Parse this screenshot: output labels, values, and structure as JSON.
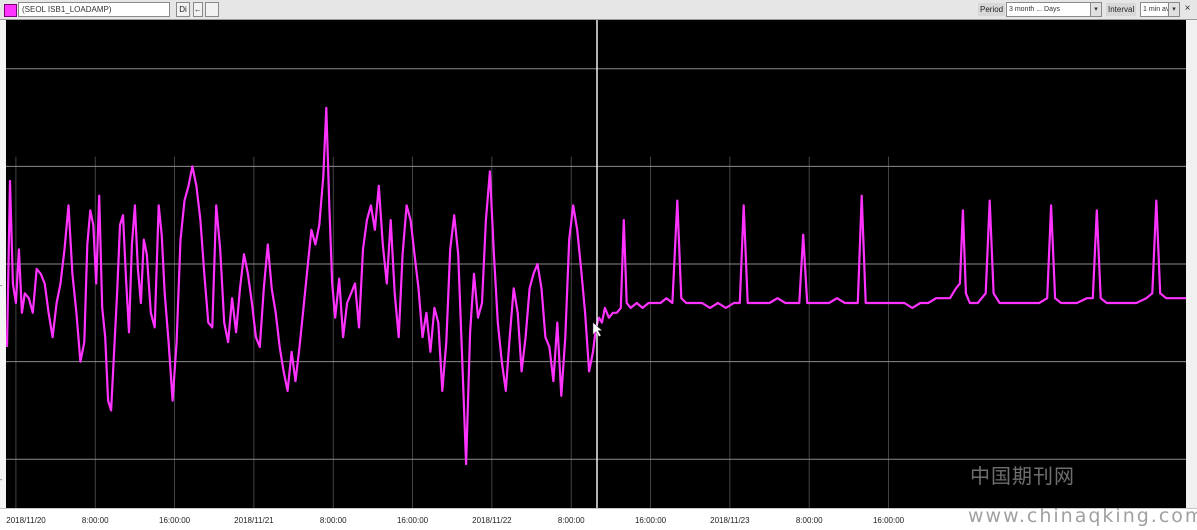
{
  "toolbar": {
    "tag_name": "(SEOL ISB1_LOADAMP)",
    "button_a": "Di",
    "button_b": "←",
    "period_label": "Period",
    "period_value": "3 month ... Days",
    "interval_label": "Interval",
    "interval_value": "1 min avg",
    "close_glyph": "×"
  },
  "colors": {
    "series": "#ff33ff",
    "background": "#000000",
    "grid": "#8a8a8a",
    "cursor": "#ffffff"
  },
  "watermark": {
    "chinese": "中国期刊网",
    "url": "www.chinaqking.com"
  },
  "chart_data": {
    "type": "line",
    "title": "",
    "xlabel": "",
    "ylabel": "",
    "x_tick_labels": [
      "2018/11/20",
      "8:00:00",
      "16:00:00",
      "2018/11/21",
      "8:00:00",
      "16:00:00",
      "2018/11/22",
      "8:00:00",
      "16:00:00",
      "2018/11/23",
      "8:00:00",
      "16:00:00"
    ],
    "x_tick_hours": [
      0,
      8,
      16,
      24,
      32,
      40,
      48,
      56,
      64,
      72,
      80,
      88
    ],
    "x_range_hours": [
      -1,
      118
    ],
    "y_range": [
      0,
      10
    ],
    "y_gridlines": [
      1,
      3,
      5,
      7,
      9
    ],
    "cursor_hour": 58.6,
    "grid": true,
    "series": [
      {
        "points": [
          [
            -0.9,
            3.3
          ],
          [
            -0.6,
            6.7
          ],
          [
            -0.3,
            4.6
          ],
          [
            0.0,
            4.2
          ],
          [
            0.3,
            5.3
          ],
          [
            0.6,
            4.0
          ],
          [
            0.9,
            4.4
          ],
          [
            1.3,
            4.3
          ],
          [
            1.7,
            4.0
          ],
          [
            2.1,
            4.9
          ],
          [
            2.5,
            4.8
          ],
          [
            2.9,
            4.6
          ],
          [
            3.3,
            4.0
          ],
          [
            3.7,
            3.5
          ],
          [
            4.1,
            4.2
          ],
          [
            4.5,
            4.6
          ],
          [
            4.9,
            5.3
          ],
          [
            5.3,
            6.2
          ],
          [
            5.7,
            4.8
          ],
          [
            6.1,
            4.0
          ],
          [
            6.5,
            3.0
          ],
          [
            6.9,
            3.4
          ],
          [
            7.2,
            5.4
          ],
          [
            7.5,
            6.1
          ],
          [
            7.8,
            5.8
          ],
          [
            8.1,
            4.6
          ],
          [
            8.4,
            6.4
          ],
          [
            8.7,
            4.1
          ],
          [
            9.0,
            3.5
          ],
          [
            9.3,
            2.2
          ],
          [
            9.6,
            2.0
          ],
          [
            9.9,
            3.2
          ],
          [
            10.2,
            4.4
          ],
          [
            10.5,
            5.8
          ],
          [
            10.8,
            6.0
          ],
          [
            11.1,
            4.7
          ],
          [
            11.4,
            3.6
          ],
          [
            11.7,
            5.4
          ],
          [
            12.0,
            6.2
          ],
          [
            12.3,
            4.9
          ],
          [
            12.6,
            4.2
          ],
          [
            12.9,
            5.5
          ],
          [
            13.2,
            5.2
          ],
          [
            13.6,
            4.0
          ],
          [
            14.0,
            3.7
          ],
          [
            14.4,
            6.2
          ],
          [
            14.7,
            5.6
          ],
          [
            15.0,
            4.4
          ],
          [
            15.4,
            3.4
          ],
          [
            15.8,
            2.2
          ],
          [
            16.2,
            3.4
          ],
          [
            16.6,
            5.5
          ],
          [
            17.0,
            6.3
          ],
          [
            17.4,
            6.6
          ],
          [
            17.8,
            7.0
          ],
          [
            18.2,
            6.6
          ],
          [
            18.6,
            5.9
          ],
          [
            19.0,
            4.8
          ],
          [
            19.4,
            3.8
          ],
          [
            19.8,
            3.7
          ],
          [
            20.2,
            6.2
          ],
          [
            20.6,
            5.3
          ],
          [
            21.0,
            3.8
          ],
          [
            21.4,
            3.4
          ],
          [
            21.8,
            4.3
          ],
          [
            22.2,
            3.6
          ],
          [
            22.6,
            4.5
          ],
          [
            23.0,
            5.2
          ],
          [
            23.4,
            4.8
          ],
          [
            23.8,
            4.2
          ],
          [
            24.2,
            3.5
          ],
          [
            24.6,
            3.3
          ],
          [
            25.0,
            4.5
          ],
          [
            25.4,
            5.4
          ],
          [
            25.8,
            4.5
          ],
          [
            26.2,
            4.0
          ],
          [
            26.6,
            3.3
          ],
          [
            27.0,
            2.8
          ],
          [
            27.4,
            2.4
          ],
          [
            27.8,
            3.2
          ],
          [
            28.2,
            2.6
          ],
          [
            28.6,
            3.3
          ],
          [
            29.0,
            4.1
          ],
          [
            29.4,
            4.9
          ],
          [
            29.8,
            5.7
          ],
          [
            30.2,
            5.4
          ],
          [
            30.6,
            5.8
          ],
          [
            31.0,
            6.8
          ],
          [
            31.3,
            8.2
          ],
          [
            31.6,
            6.2
          ],
          [
            31.9,
            4.6
          ],
          [
            32.2,
            3.9
          ],
          [
            32.6,
            4.7
          ],
          [
            33.0,
            3.5
          ],
          [
            33.4,
            4.2
          ],
          [
            33.8,
            4.4
          ],
          [
            34.2,
            4.6
          ],
          [
            34.6,
            3.7
          ],
          [
            35.0,
            5.3
          ],
          [
            35.4,
            5.9
          ],
          [
            35.8,
            6.2
          ],
          [
            36.2,
            5.7
          ],
          [
            36.6,
            6.6
          ],
          [
            37.0,
            5.4
          ],
          [
            37.4,
            4.6
          ],
          [
            37.8,
            5.9
          ],
          [
            38.2,
            4.4
          ],
          [
            38.6,
            3.5
          ],
          [
            39.0,
            5.2
          ],
          [
            39.4,
            6.2
          ],
          [
            39.8,
            5.9
          ],
          [
            40.2,
            5.2
          ],
          [
            40.6,
            4.5
          ],
          [
            41.0,
            3.5
          ],
          [
            41.4,
            4.0
          ],
          [
            41.8,
            3.2
          ],
          [
            42.2,
            4.1
          ],
          [
            42.6,
            3.8
          ],
          [
            43.0,
            2.4
          ],
          [
            43.4,
            3.4
          ],
          [
            43.8,
            5.3
          ],
          [
            44.2,
            6.0
          ],
          [
            44.6,
            5.2
          ],
          [
            45.0,
            3.1
          ],
          [
            45.4,
            0.9
          ],
          [
            45.8,
            3.6
          ],
          [
            46.2,
            4.8
          ],
          [
            46.6,
            3.9
          ],
          [
            47.0,
            4.2
          ],
          [
            47.4,
            5.9
          ],
          [
            47.8,
            6.9
          ],
          [
            48.2,
            5.2
          ],
          [
            48.6,
            3.8
          ],
          [
            49.0,
            3.0
          ],
          [
            49.4,
            2.4
          ],
          [
            49.8,
            3.5
          ],
          [
            50.2,
            4.5
          ],
          [
            50.6,
            4.0
          ],
          [
            51.0,
            2.8
          ],
          [
            51.4,
            3.5
          ],
          [
            51.8,
            4.5
          ],
          [
            52.2,
            4.8
          ],
          [
            52.6,
            5.0
          ],
          [
            53.0,
            4.5
          ],
          [
            53.4,
            3.5
          ],
          [
            53.8,
            3.3
          ],
          [
            54.2,
            2.6
          ],
          [
            54.6,
            3.8
          ],
          [
            55.0,
            2.3
          ],
          [
            55.4,
            3.5
          ],
          [
            55.8,
            5.5
          ],
          [
            56.2,
            6.2
          ],
          [
            56.6,
            5.7
          ],
          [
            57.0,
            4.9
          ],
          [
            57.4,
            4.0
          ],
          [
            57.8,
            2.8
          ],
          [
            58.2,
            3.2
          ],
          [
            58.5,
            3.7
          ],
          [
            58.8,
            3.9
          ],
          [
            59.1,
            3.8
          ],
          [
            59.4,
            4.1
          ],
          [
            59.8,
            3.9
          ],
          [
            60.2,
            4.0
          ],
          [
            60.6,
            4.0
          ],
          [
            61.0,
            4.1
          ],
          [
            61.3,
            5.9
          ],
          [
            61.6,
            4.2
          ],
          [
            62.0,
            4.1
          ],
          [
            62.6,
            4.2
          ],
          [
            63.2,
            4.1
          ],
          [
            63.8,
            4.2
          ],
          [
            64.4,
            4.2
          ],
          [
            65.0,
            4.2
          ],
          [
            65.6,
            4.3
          ],
          [
            66.2,
            4.2
          ],
          [
            66.7,
            6.3
          ],
          [
            67.1,
            4.3
          ],
          [
            67.6,
            4.2
          ],
          [
            68.4,
            4.2
          ],
          [
            69.2,
            4.2
          ],
          [
            70.0,
            4.1
          ],
          [
            70.8,
            4.2
          ],
          [
            71.6,
            4.1
          ],
          [
            72.4,
            4.2
          ],
          [
            73.0,
            4.2
          ],
          [
            73.4,
            6.2
          ],
          [
            73.8,
            4.2
          ],
          [
            74.4,
            4.2
          ],
          [
            75.2,
            4.2
          ],
          [
            76.0,
            4.2
          ],
          [
            76.8,
            4.3
          ],
          [
            77.6,
            4.2
          ],
          [
            78.4,
            4.2
          ],
          [
            79.0,
            4.2
          ],
          [
            79.4,
            5.6
          ],
          [
            79.8,
            4.2
          ],
          [
            80.4,
            4.2
          ],
          [
            81.2,
            4.2
          ],
          [
            82.0,
            4.2
          ],
          [
            82.8,
            4.3
          ],
          [
            83.6,
            4.2
          ],
          [
            84.4,
            4.2
          ],
          [
            84.9,
            4.2
          ],
          [
            85.3,
            6.4
          ],
          [
            85.7,
            4.2
          ],
          [
            86.4,
            4.2
          ],
          [
            87.2,
            4.2
          ],
          [
            88.0,
            4.2
          ],
          [
            88.8,
            4.2
          ],
          [
            89.6,
            4.2
          ],
          [
            90.4,
            4.1
          ],
          [
            91.2,
            4.2
          ],
          [
            92.0,
            4.2
          ],
          [
            92.8,
            4.3
          ],
          [
            93.6,
            4.3
          ],
          [
            94.2,
            4.3
          ],
          [
            94.8,
            4.5
          ],
          [
            95.2,
            4.6
          ],
          [
            95.5,
            6.1
          ],
          [
            95.8,
            4.4
          ],
          [
            96.2,
            4.2
          ],
          [
            97.0,
            4.2
          ],
          [
            97.8,
            4.4
          ],
          [
            98.2,
            6.3
          ],
          [
            98.6,
            4.4
          ],
          [
            99.2,
            4.2
          ],
          [
            100.0,
            4.2
          ],
          [
            100.8,
            4.2
          ],
          [
            101.6,
            4.2
          ],
          [
            102.4,
            4.2
          ],
          [
            103.2,
            4.2
          ],
          [
            104.0,
            4.3
          ],
          [
            104.4,
            6.2
          ],
          [
            104.8,
            4.3
          ],
          [
            105.4,
            4.2
          ],
          [
            106.2,
            4.2
          ],
          [
            107.0,
            4.2
          ],
          [
            108.0,
            4.3
          ],
          [
            108.6,
            4.3
          ],
          [
            109.0,
            6.1
          ],
          [
            109.4,
            4.3
          ],
          [
            110.0,
            4.2
          ],
          [
            111.0,
            4.2
          ],
          [
            112.0,
            4.2
          ],
          [
            113.0,
            4.2
          ],
          [
            114.0,
            4.3
          ],
          [
            114.6,
            4.4
          ],
          [
            115.0,
            6.3
          ],
          [
            115.4,
            4.4
          ],
          [
            116.0,
            4.3
          ],
          [
            117.0,
            4.3
          ],
          [
            118.0,
            4.3
          ]
        ]
      }
    ]
  }
}
